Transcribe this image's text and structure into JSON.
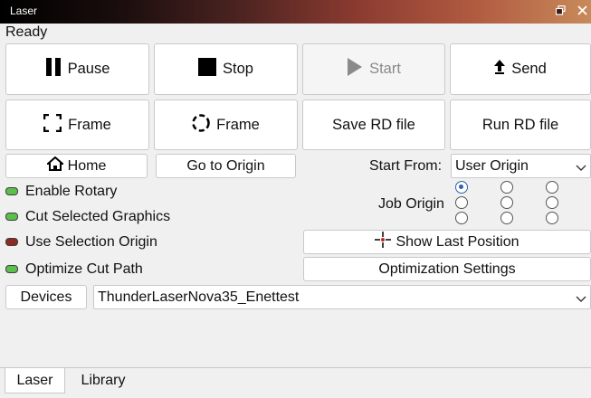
{
  "window": {
    "title": "Laser"
  },
  "status": "Ready",
  "buttons": {
    "pause": "Pause",
    "stop": "Stop",
    "start": "Start",
    "send": "Send",
    "frame_rect": "Frame",
    "frame_circle": "Frame",
    "save_rd": "Save RD file",
    "run_rd": "Run RD file",
    "home": "Home",
    "go_to_origin": "Go to Origin",
    "show_last_position": "Show Last Position",
    "optimization_settings": "Optimization Settings",
    "devices": "Devices"
  },
  "start_from": {
    "label": "Start From:",
    "value": "User Origin"
  },
  "job_origin": {
    "label": "Job Origin",
    "selected_index": 0
  },
  "options": [
    {
      "label": "Enable Rotary",
      "state": "on"
    },
    {
      "label": "Cut Selected Graphics",
      "state": "on"
    },
    {
      "label": "Use Selection Origin",
      "state": "off"
    },
    {
      "label": "Optimize Cut Path",
      "state": "on"
    }
  ],
  "device": {
    "value": "ThunderLaserNova35_Enettest"
  },
  "tabs": [
    "Laser",
    "Library"
  ],
  "colors": {
    "toggle_on": "#5bbf4b",
    "toggle_off": "#8a2c22",
    "radio_accent": "#2f62b0"
  }
}
